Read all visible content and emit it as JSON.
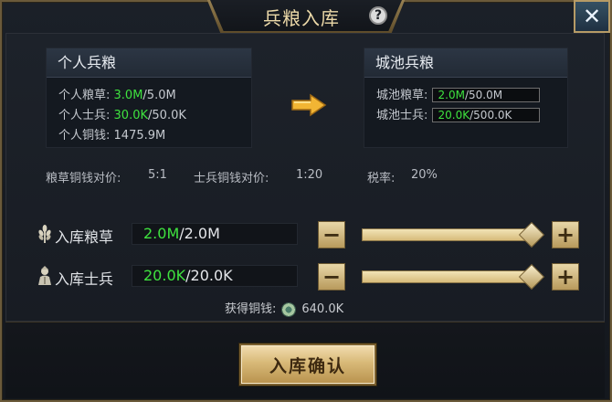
{
  "title": "兵粮入库",
  "personal": {
    "heading": "个人兵粮",
    "grain_label": "个人粮草:",
    "grain_current": "3.0M",
    "grain_max": "/5.0M",
    "troops_label": "个人士兵:",
    "troops_current": "30.0K",
    "troops_max": "/50.0K",
    "copper_label": "个人铜钱:",
    "copper_value": "1475.9M"
  },
  "city": {
    "heading": "城池兵粮",
    "grain_label": "城池粮草:",
    "grain_current": "2.0M",
    "grain_max": "/50.0M",
    "troops_label": "城池士兵:",
    "troops_current": "20.0K",
    "troops_max": "/500.0K"
  },
  "rates": {
    "grain_rate_label": "粮草铜钱对价:",
    "grain_rate_value": "5:1",
    "troop_rate_label": "士兵铜钱对价:",
    "troop_rate_value": "1:20",
    "tax_label": "税率:",
    "tax_value": "20%"
  },
  "deposit_grain": {
    "label": "入库粮草",
    "current": "2.0M",
    "max": "/2.0M",
    "icon": "wheat-icon",
    "slider_fraction": 1.0
  },
  "deposit_troops": {
    "label": "入库士兵",
    "current": "20.0K",
    "max": "/20.0K",
    "icon": "soldier-icon",
    "slider_fraction": 1.0
  },
  "gain": {
    "label": "获得铜钱:",
    "value": "640.0K"
  },
  "confirm_label": "入库确认",
  "help_symbol": "?",
  "close_symbol": "✕",
  "minus_symbol": "−",
  "plus_symbol": "+",
  "colors": {
    "accent_gold": "#d8b978",
    "highlight_green": "#3fe23f"
  }
}
